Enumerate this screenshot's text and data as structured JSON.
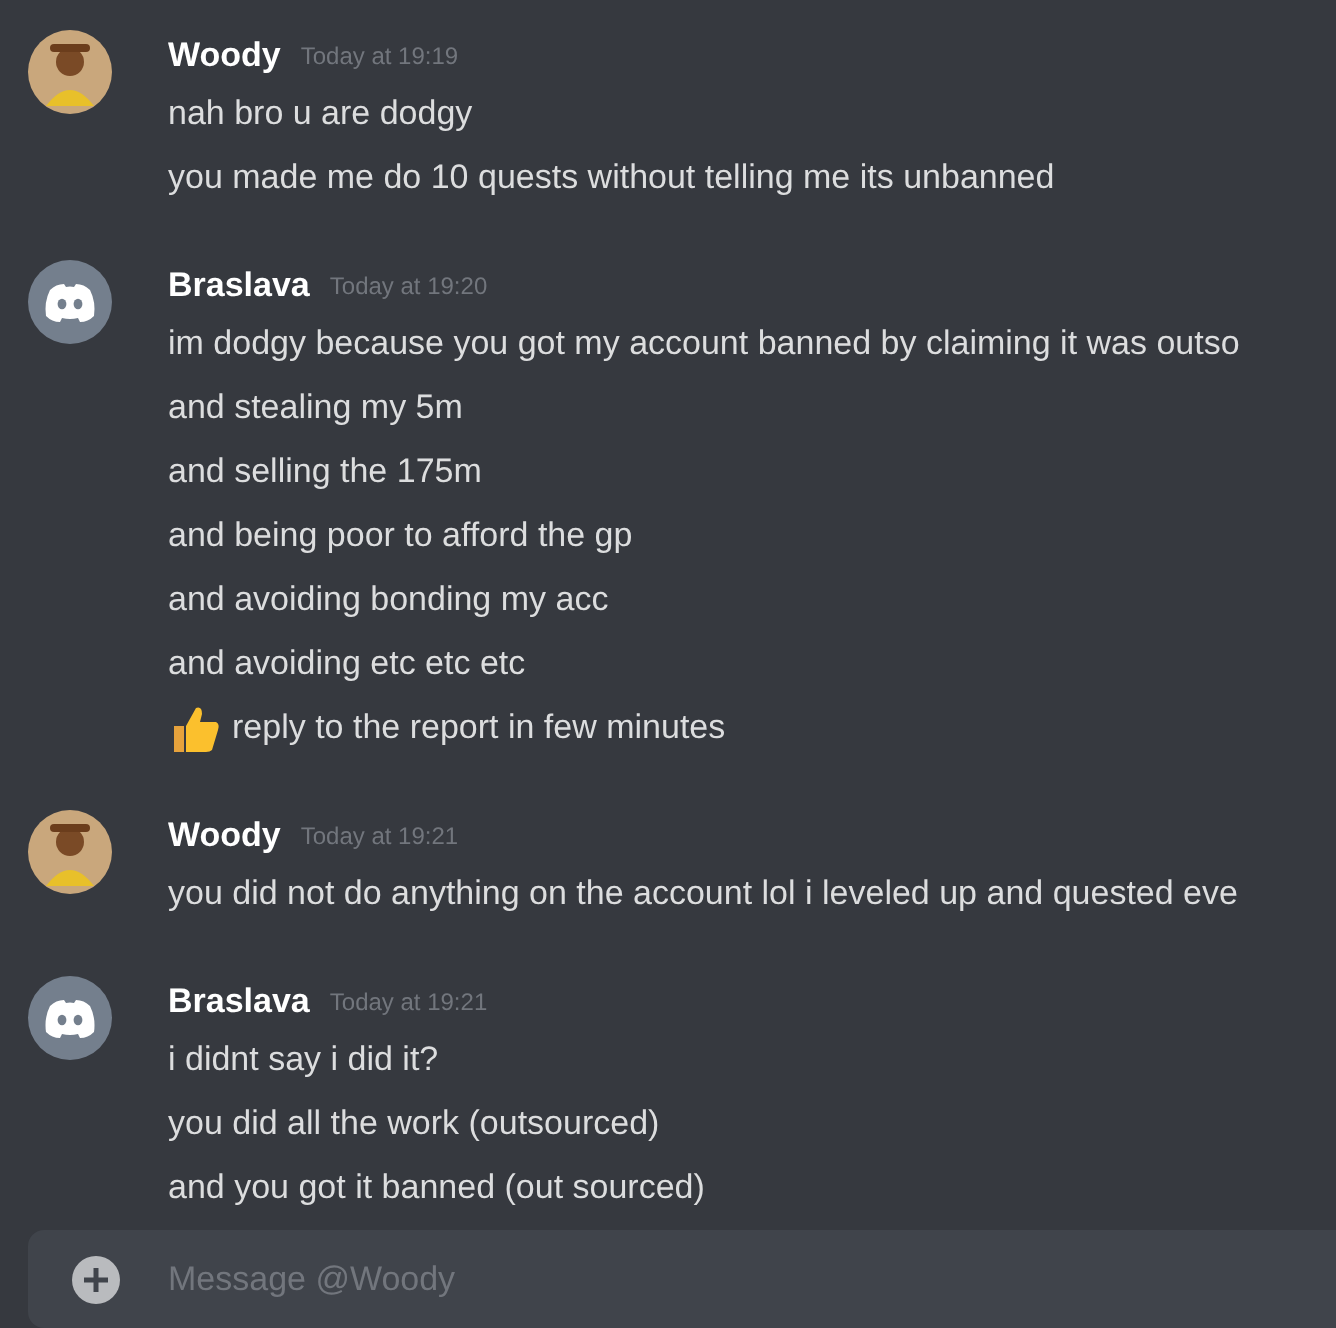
{
  "messages": [
    {
      "author": "Woody",
      "timestamp": "Today at 19:19",
      "avatar": {
        "kind": "figure"
      },
      "lines": [
        {
          "kind": "text",
          "text": "nah bro u are dodgy"
        },
        {
          "kind": "text",
          "text": "you made me do 10 quests without telling me its unbanned"
        }
      ]
    },
    {
      "author": "Braslava",
      "timestamp": "Today at 19:20",
      "avatar": {
        "kind": "default"
      },
      "lines": [
        {
          "kind": "text",
          "text": "im dodgy because you got my account banned by claiming it was outso"
        },
        {
          "kind": "text",
          "text": "and stealing my 5m"
        },
        {
          "kind": "text",
          "text": "and selling the 175m"
        },
        {
          "kind": "text",
          "text": "and being poor to afford the gp"
        },
        {
          "kind": "text",
          "text": "and avoiding bonding my acc"
        },
        {
          "kind": "text",
          "text": "and avoiding etc etc etc"
        },
        {
          "kind": "thumbs_up",
          "text": "reply to the report in few minutes"
        }
      ]
    },
    {
      "author": "Woody",
      "timestamp": "Today at 19:21",
      "avatar": {
        "kind": "figure"
      },
      "lines": [
        {
          "kind": "text",
          "text": "you did not do anything on the account lol i leveled up and quested eve"
        }
      ]
    },
    {
      "author": "Braslava",
      "timestamp": "Today at 19:21",
      "avatar": {
        "kind": "default"
      },
      "lines": [
        {
          "kind": "text",
          "text": "i didnt say i did it?"
        },
        {
          "kind": "text",
          "text": "you did all the work (outsourced)"
        },
        {
          "kind": "text",
          "text": "and you got it banned (out sourced)"
        }
      ]
    }
  ],
  "composer": {
    "placeholder": "Message @Woody"
  }
}
